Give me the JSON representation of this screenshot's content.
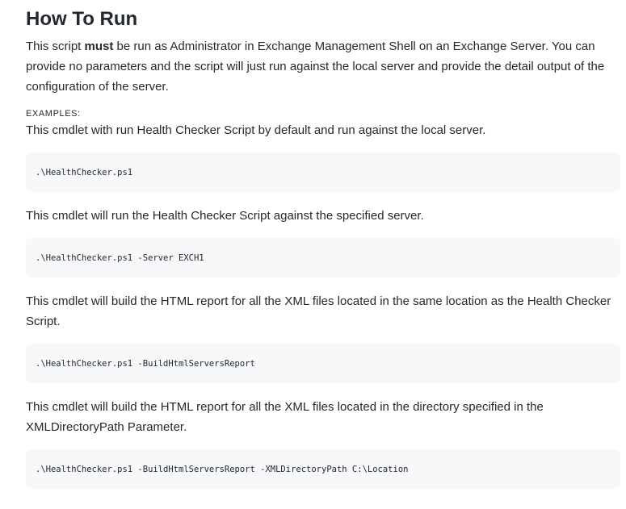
{
  "section": {
    "title": "How To Run",
    "intro_pre": "This script ",
    "intro_bold": "must",
    "intro_post": " be run as Administrator in Exchange Management Shell on an Exchange Server. You can provide no parameters and the script will just run against the local server and provide the detail output of the configuration of the server.",
    "examples_label": "EXAMPLES:"
  },
  "examples": [
    {
      "description": "This cmdlet with run Health Checker Script by default and run against the local server.",
      "code": ".\\HealthChecker.ps1"
    },
    {
      "description": "This cmdlet will run the Health Checker Script against the specified server.",
      "code": ".\\HealthChecker.ps1 -Server EXCH1"
    },
    {
      "description": "This cmdlet will build the HTML report for all the XML files located in the same location as the Health Checker Script.",
      "code": ".\\HealthChecker.ps1 -BuildHtmlServersReport"
    },
    {
      "description": "This cmdlet will build the HTML report for all the XML files located in the directory specified in the XMLDirectoryPath Parameter.",
      "code": ".\\HealthChecker.ps1 -BuildHtmlServersReport -XMLDirectoryPath C:\\Location"
    }
  ]
}
